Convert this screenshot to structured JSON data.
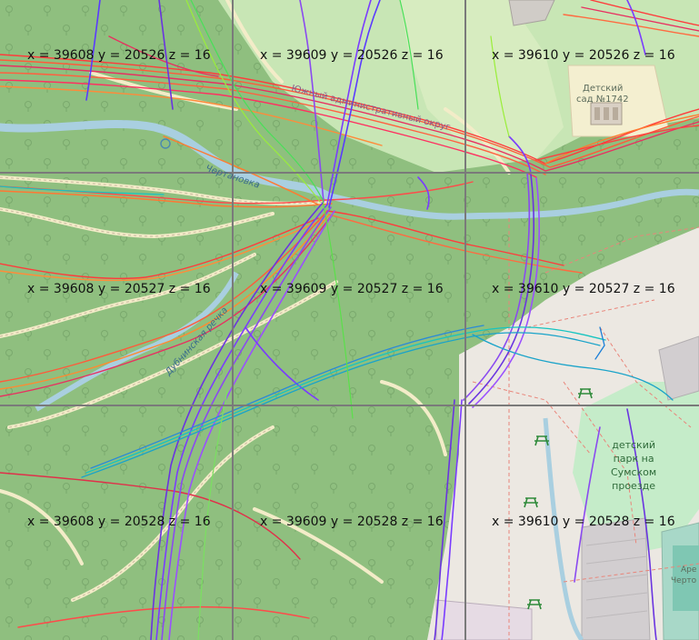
{
  "tiles": [
    {
      "label": "x = 39608  y = 20526  z = 16"
    },
    {
      "label": "x = 39609  y = 20526  z = 16"
    },
    {
      "label": "x = 39610  y = 20526  z = 16"
    },
    {
      "label": "x = 39608  y = 20527  z = 16"
    },
    {
      "label": "x = 39609  y = 20527  z = 16"
    },
    {
      "label": "x = 39610  y = 20527  z = 16"
    },
    {
      "label": "x = 39608  y = 20528  z = 16"
    },
    {
      "label": "x = 39609  y = 20528  z = 16"
    },
    {
      "label": "x = 39610  y = 20528  z = 16"
    }
  ],
  "labels": {
    "kindergarten_line1": "Детский",
    "kindergarten_line2": "сад №1742",
    "district": "Южный административный округ",
    "river_chertanovka": "Чертановка",
    "river_dubninskaya": "Дубнинская речка",
    "park_line1": "детский",
    "park_line2": "парк на",
    "park_line3": "Сумском",
    "park_line4": "проезде",
    "arena_line1": "Аре",
    "arena_line2": "Черто"
  },
  "colors": {
    "forest": "#8fbf7f",
    "park_light": "#c8e6b5",
    "residential": "#ece8e2",
    "water": "#a9cfe0",
    "grid": "#7a7a7a"
  },
  "icons": [
    "tree-icon",
    "picnic-table-icon",
    "kindergarten-building-icon"
  ]
}
